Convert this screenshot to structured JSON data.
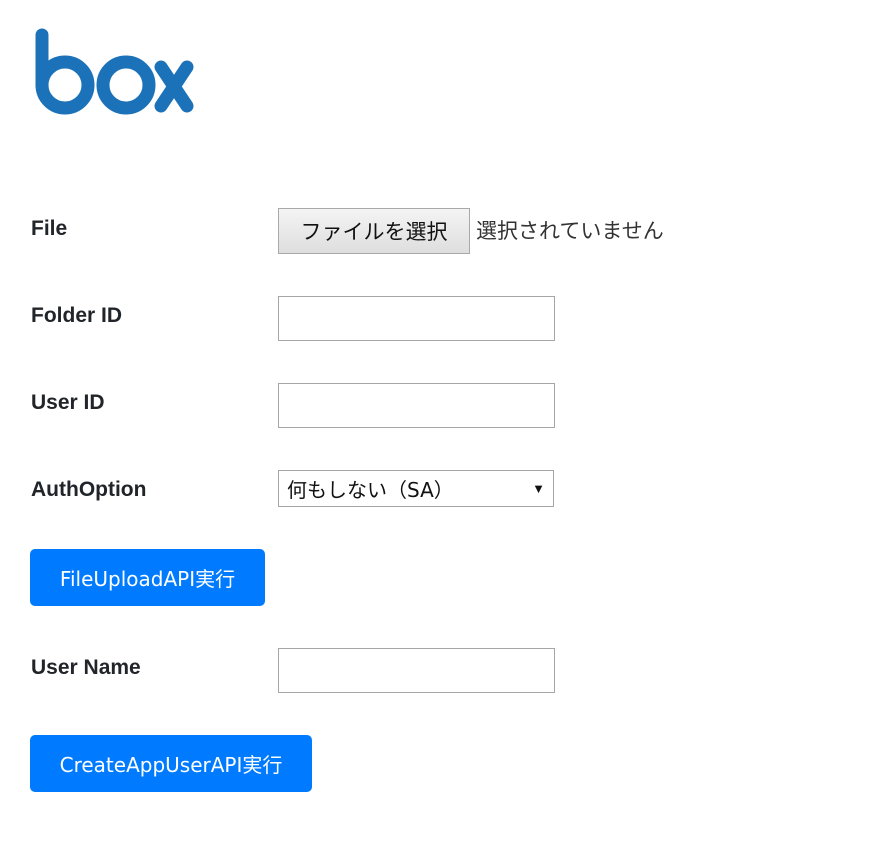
{
  "logo": {
    "text": "box",
    "color": "#1c72b8"
  },
  "form": {
    "file": {
      "label": "File",
      "button_label": "ファイルを選択",
      "status": "選択されていません"
    },
    "folder_id": {
      "label": "Folder ID",
      "value": ""
    },
    "user_id": {
      "label": "User ID",
      "value": ""
    },
    "auth_option": {
      "label": "AuthOption",
      "selected": "何もしない（SA）"
    },
    "upload_button_label": "FileUploadAPI実行",
    "user_name": {
      "label": "User Name",
      "value": ""
    },
    "create_button_label": "CreateAppUserAPI実行"
  },
  "colors": {
    "primary": "#007bff",
    "input_border": "#a6a6a6"
  }
}
